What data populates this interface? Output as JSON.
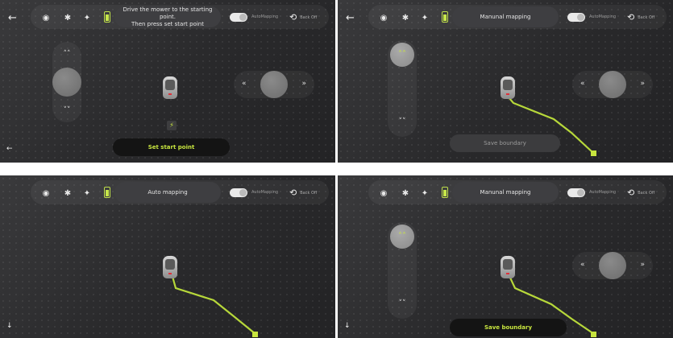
{
  "panels": [
    {
      "message": "Drive the mower to the starting point. Then press set start point",
      "message_line1": "Drive the mower to the starting point.",
      "message_line2": "Then press set start point",
      "auto_mapping_label": "AutoMapping",
      "back_off_label": "Back Off",
      "action_button": "Set start point"
    },
    {
      "message": "Manunal mapping",
      "auto_mapping_label": "AutoMapping",
      "back_off_label": "Back Off",
      "action_button": "Save boundary"
    },
    {
      "message": "Auto mapping",
      "auto_mapping_label": "AutoMapping",
      "back_off_label": "Back Off"
    },
    {
      "message": "Manunal mapping",
      "auto_mapping_label": "AutoMapping",
      "back_off_label": "Back Off",
      "action_button": "Save boundary"
    }
  ],
  "icons": {
    "back": "arrow-left-icon",
    "wifi": "wifi-icon",
    "bluetooth": "bluetooth-icon",
    "satellite": "satellite-icon",
    "battery": "battery-icon",
    "undo": "undo-icon",
    "charge": "lightning-icon"
  },
  "colors": {
    "accent": "#c8e53f",
    "background": "#2c2c2e",
    "trail": "#b7d83a"
  }
}
